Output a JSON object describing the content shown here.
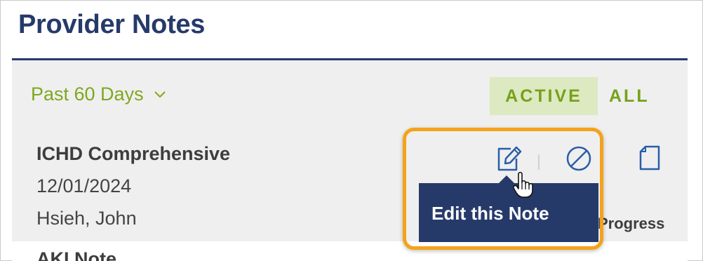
{
  "header": {
    "title": "Provider Notes"
  },
  "filters": {
    "date_range": "Past 60 Days",
    "toggle_active": "ACTIVE",
    "toggle_all": "ALL"
  },
  "notes": [
    {
      "name": "ICHD Comprehensive",
      "date": "12/01/2024",
      "author": "Hsieh, John"
    },
    {
      "name": "AKI Note"
    }
  ],
  "actions": {
    "tooltip": "Edit this Note",
    "status_label": "Progress"
  },
  "colors": {
    "navy": "#263a6a",
    "green": "#76a21b",
    "active_bg": "#dde9c1",
    "highlight": "#f5a21a"
  },
  "icons": [
    "chevron-down-icon",
    "edit-icon",
    "void-icon",
    "document-icon",
    "hand-cursor-icon"
  ]
}
